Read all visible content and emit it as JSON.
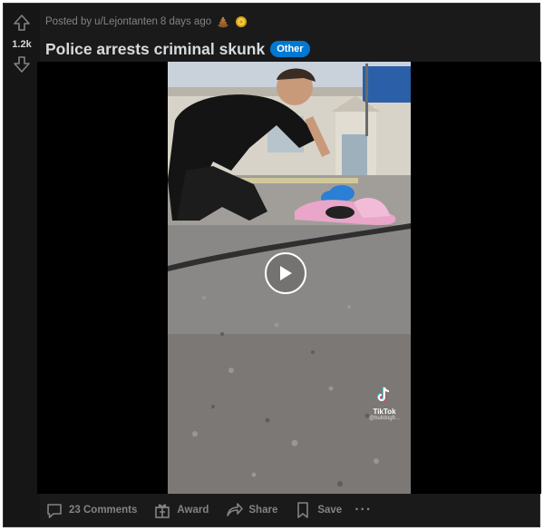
{
  "vote": {
    "count": "1.2k"
  },
  "post": {
    "posted_by": "Posted by",
    "author": "u/Lejontanten",
    "age": "8 days ago",
    "awards": [
      "poop-award-icon",
      "gold-award-icon"
    ],
    "title": "Police arrests criminal skunk",
    "flair": "Other"
  },
  "video": {
    "watermark_brand": "TikTok",
    "watermark_user": "@bulldogfr..."
  },
  "actions": {
    "comments": "23 Comments",
    "award": "Award",
    "share": "Share",
    "save": "Save",
    "more": "···"
  },
  "colors": {
    "card_bg": "#1a1a1b",
    "text": "#d7dadc",
    "muted": "#818384",
    "flair": "#0079d3"
  }
}
